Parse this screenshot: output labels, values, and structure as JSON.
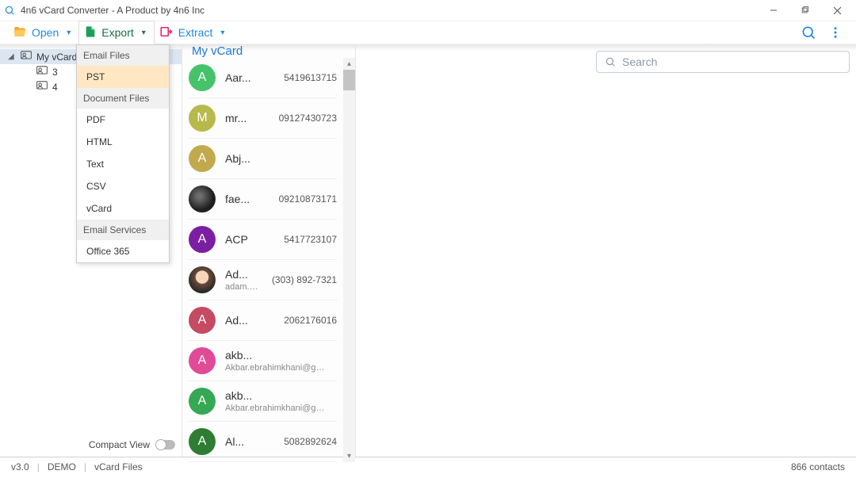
{
  "window_title": "4n6 vCard Converter - A Product by 4n6 Inc",
  "toolbar": {
    "open": "Open",
    "export": "Export",
    "extract": "Extract"
  },
  "export_menu": {
    "sections": [
      {
        "header": "Email Files",
        "items": [
          "PST"
        ]
      },
      {
        "header": "Document Files",
        "items": [
          "PDF",
          "HTML",
          "Text",
          "CSV",
          "vCard"
        ]
      },
      {
        "header": "Email Services",
        "items": [
          "Office 365"
        ]
      }
    ],
    "active": "PST"
  },
  "tree": {
    "root": "My vCard",
    "kids": [
      "3",
      "4"
    ]
  },
  "compact_label": "Compact View",
  "list_title": "My vCard",
  "search_placeholder": "Search",
  "contacts": [
    {
      "initial": "A",
      "bg": "#46C36A",
      "name": "Aar...",
      "right": "5419613715"
    },
    {
      "initial": "M",
      "bg": "#B7B94A",
      "name": "mr...",
      "right": "09127430723"
    },
    {
      "initial": "A",
      "bg": "#C2A94E",
      "name": "Abj...",
      "right": ""
    },
    {
      "photo": true,
      "name": "fae...",
      "right": "09210873171"
    },
    {
      "initial": "A",
      "bg": "#7B1FA2",
      "name": "ACP",
      "right": "5417723107"
    },
    {
      "photo": true,
      "name": "Ad...",
      "right": "(303) 892-7321",
      "sub": "adam.cohen@dgslaw.com",
      "photo2": true
    },
    {
      "initial": "A",
      "bg": "#C44B62",
      "name": "Ad...",
      "right": "2062176016"
    },
    {
      "initial": "A",
      "bg": "#E04A97",
      "name": "akb...",
      "right": "",
      "sub": "Akbar.ebrahimkhani@gmail.co"
    },
    {
      "initial": "A",
      "bg": "#34A853",
      "name": "akb...",
      "right": "",
      "sub": "Akbar.ebrahimkhani@gmail.co"
    },
    {
      "initial": "A",
      "bg": "#2E7D32",
      "name": "Al...",
      "right": "5082892624"
    }
  ],
  "status": {
    "left1": "v3.0",
    "left2": "DEMO",
    "left3": "vCard Files",
    "right": "866  contacts"
  }
}
